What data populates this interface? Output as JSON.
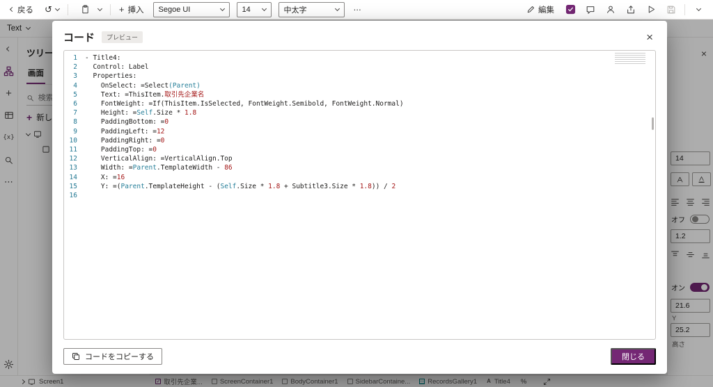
{
  "topbar": {
    "back_label": "戻る",
    "insert_label": "挿入",
    "font_family": "Segoe UI",
    "font_size": "14",
    "font_weight": "中太字",
    "more_label": "⋯",
    "edit_label": "編集"
  },
  "formula_bar": {
    "property_selector": "Text"
  },
  "tree_panel": {
    "title": "ツリービュー",
    "tab_screens": "画面",
    "search_placeholder": "検索",
    "new_screen_label": "新しい画面"
  },
  "right_panel": {
    "font_size_value": "14",
    "off_label": "オフ",
    "line_height_value": "1.2",
    "on_label": "オン",
    "y_value": "21.6",
    "y_label": "Y",
    "height_value": "25.2",
    "height_label": "高さ"
  },
  "modal": {
    "title": "コード",
    "badge": "プレビュー",
    "copy_button_label": "コードをコピーする",
    "close_button_label": "閉じる"
  },
  "code": {
    "lines": [
      {
        "n": "1",
        "segments": [
          {
            "t": "- Title4:",
            "c": "d"
          }
        ]
      },
      {
        "n": "2",
        "segments": [
          {
            "t": "  Control: Label",
            "c": "d"
          }
        ]
      },
      {
        "n": "3",
        "segments": [
          {
            "t": "  Properties:",
            "c": "d"
          }
        ]
      },
      {
        "n": "4",
        "segments": [
          {
            "t": "    OnSelect: =Select",
            "c": "d"
          },
          {
            "t": "(Parent)",
            "c": "b"
          }
        ]
      },
      {
        "n": "5",
        "segments": [
          {
            "t": "    Text: =ThisItem.",
            "c": "d"
          },
          {
            "t": "取引先企業名",
            "c": "r"
          }
        ]
      },
      {
        "n": "6",
        "segments": [
          {
            "t": "    FontWeight: =If(ThisItem.IsSelected, FontWeight.Semibold, FontWeight.Normal)",
            "c": "d"
          }
        ]
      },
      {
        "n": "7",
        "segments": [
          {
            "t": "    Height: =",
            "c": "d"
          },
          {
            "t": "Self",
            "c": "b"
          },
          {
            "t": ".Size * ",
            "c": "d"
          },
          {
            "t": "1.8",
            "c": "r"
          }
        ]
      },
      {
        "n": "8",
        "segments": [
          {
            "t": "    PaddingBottom: =",
            "c": "d"
          },
          {
            "t": "0",
            "c": "r"
          }
        ]
      },
      {
        "n": "9",
        "segments": [
          {
            "t": "    PaddingLeft: =",
            "c": "d"
          },
          {
            "t": "12",
            "c": "r"
          }
        ]
      },
      {
        "n": "10",
        "segments": [
          {
            "t": "    PaddingRight: =",
            "c": "d"
          },
          {
            "t": "0",
            "c": "r"
          }
        ]
      },
      {
        "n": "11",
        "segments": [
          {
            "t": "    PaddingTop: =",
            "c": "d"
          },
          {
            "t": "0",
            "c": "r"
          }
        ]
      },
      {
        "n": "12",
        "segments": [
          {
            "t": "    VerticalAlign: =VerticalAlign.Top",
            "c": "d"
          }
        ]
      },
      {
        "n": "13",
        "segments": [
          {
            "t": "    Width: =",
            "c": "d"
          },
          {
            "t": "Parent",
            "c": "b"
          },
          {
            "t": ".TemplateWidth - ",
            "c": "d"
          },
          {
            "t": "86",
            "c": "r"
          }
        ]
      },
      {
        "n": "14",
        "segments": [
          {
            "t": "    X: =",
            "c": "d"
          },
          {
            "t": "16",
            "c": "r"
          }
        ]
      },
      {
        "n": "15",
        "segments": [
          {
            "t": "    Y: =(",
            "c": "d"
          },
          {
            "t": "Parent",
            "c": "b"
          },
          {
            "t": ".TemplateHeight - (",
            "c": "d"
          },
          {
            "t": "Self",
            "c": "b"
          },
          {
            "t": ".Size * ",
            "c": "d"
          },
          {
            "t": "1.8",
            "c": "r"
          },
          {
            "t": " + Subtitle3.Size * ",
            "c": "d"
          },
          {
            "t": "1.8",
            "c": "r"
          },
          {
            "t": ")) / ",
            "c": "d"
          },
          {
            "t": "2",
            "c": "r"
          }
        ]
      },
      {
        "n": "16",
        "segments": []
      }
    ]
  },
  "statusbar": {
    "screen_name": "Screen1",
    "breadcrumbs": [
      {
        "label": "取引先企業...",
        "icon": "checkbox"
      },
      {
        "label": "ScreenContainer1",
        "icon": "container"
      },
      {
        "label": "BodyContainer1",
        "icon": "container"
      },
      {
        "label": "SidebarContaine...",
        "icon": "container"
      },
      {
        "label": "RecordsGallery1",
        "icon": "gallery"
      },
      {
        "label": "Title4",
        "icon": "label"
      }
    ],
    "zoom_label": "%"
  },
  "colors": {
    "accent": "#742774",
    "token_keyword": "#267f99",
    "token_number": "#a31515",
    "line_number": "#237893"
  }
}
